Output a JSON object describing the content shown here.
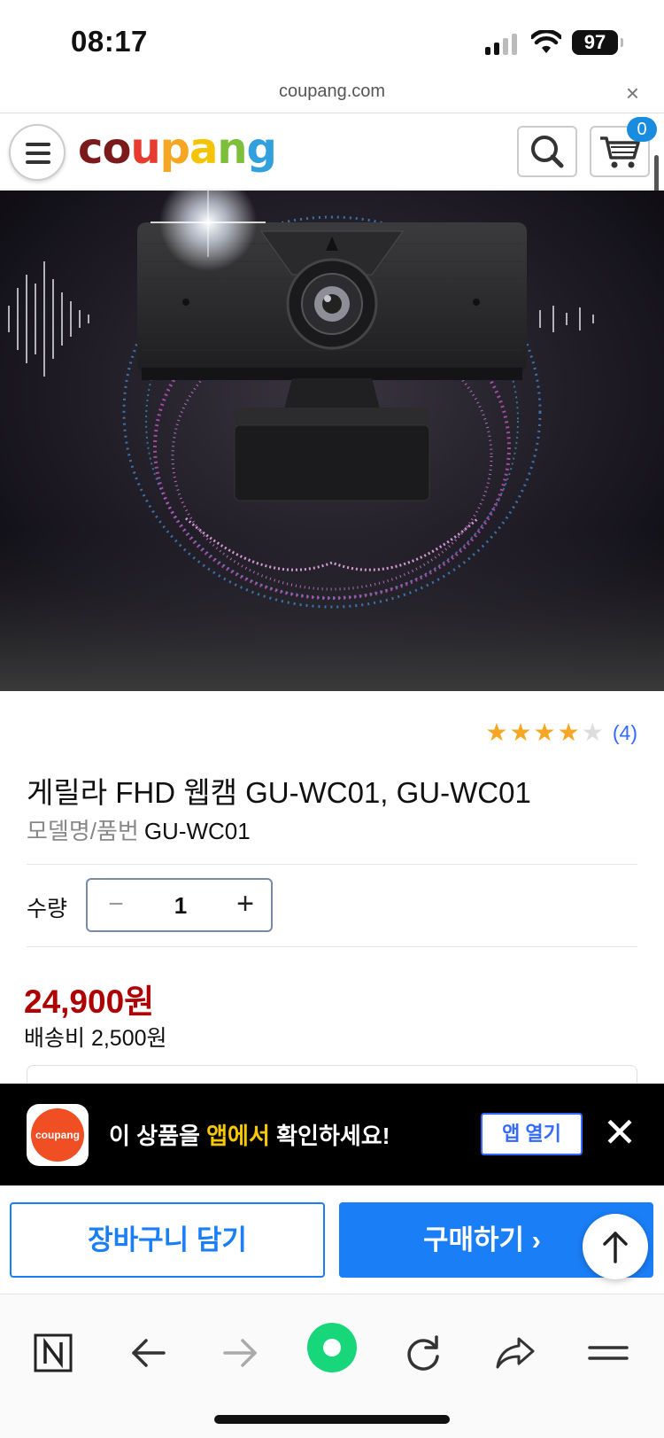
{
  "status_bar": {
    "time": "08:17",
    "battery": "97"
  },
  "browser": {
    "url": "coupang.com",
    "close_glyph": "×"
  },
  "site": {
    "logo_letters": [
      {
        "ch": "c",
        "color": "#7a1a1a"
      },
      {
        "ch": "o",
        "color": "#7a1a1a"
      },
      {
        "ch": "u",
        "color": "#e63b2e"
      },
      {
        "ch": "p",
        "color": "#f5a623"
      },
      {
        "ch": "a",
        "color": "#f5c400"
      },
      {
        "ch": "n",
        "color": "#7cbf3a"
      },
      {
        "ch": "g",
        "color": "#32a0dc"
      }
    ],
    "cart_count": "0"
  },
  "product": {
    "rating": 4,
    "rating_max": 5,
    "review_count": "(4)",
    "title": "게릴라 FHD 웹캠 GU-WC01, GU-WC01",
    "model_label": "모델명/품번",
    "model_value": "GU-WC01",
    "quantity_label": "수량",
    "quantity": "1",
    "price": "24,900원",
    "shipping": "배송비 2,500원"
  },
  "app_banner": {
    "icon_text": "coupang",
    "text_before": "이 상품을 ",
    "text_highlight": "앱에서",
    "text_after": " 확인하세요!",
    "open_button": "앱 열기",
    "close_glyph": "✕"
  },
  "actions": {
    "add_to_cart": "장바구니 담기",
    "buy_now": "구매하기 ›"
  },
  "toolbar": {
    "items": [
      "n-logo-icon",
      "back-arrow-icon",
      "forward-arrow-icon",
      "green-dot-icon",
      "reload-icon",
      "share-icon",
      "menu-icon"
    ]
  },
  "colors": {
    "accent_blue": "#1a7ef7",
    "price_red": "#ae0000",
    "star_yellow": "#f5a623",
    "banner_highlight": "#f7c800"
  }
}
